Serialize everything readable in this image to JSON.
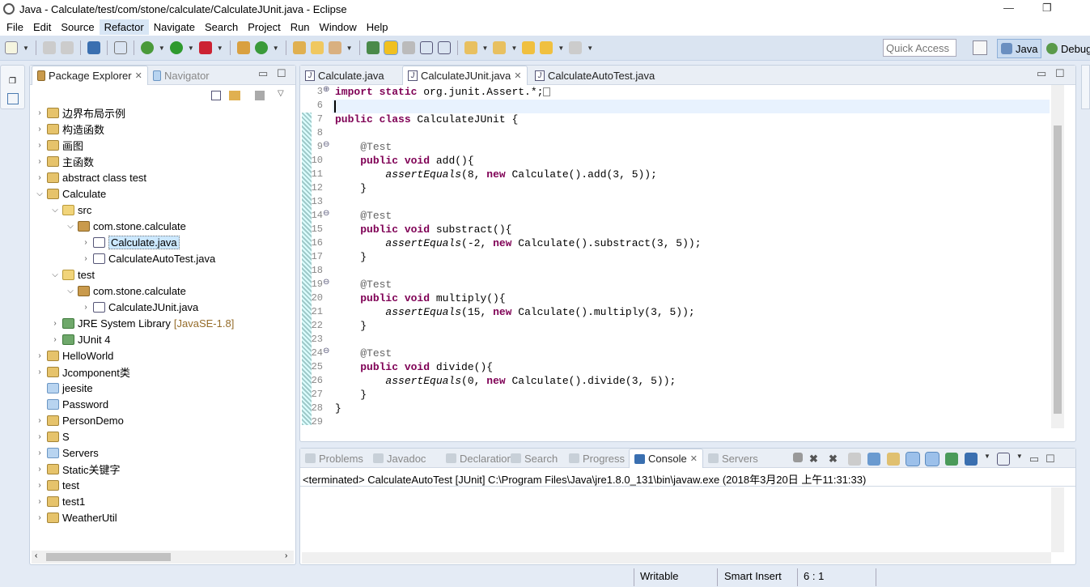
{
  "window": {
    "title": "Java - Calculate/test/com/stone/calculate/CalculateJUnit.java - Eclipse"
  },
  "menu": [
    "File",
    "Edit",
    "Source",
    "Refactor",
    "Navigate",
    "Search",
    "Project",
    "Run",
    "Window",
    "Help"
  ],
  "toolbar": {
    "quick_access_placeholder": "Quick Access",
    "perspectives": [
      "Java",
      "Debug"
    ]
  },
  "explorer": {
    "tabs": [
      {
        "label": "Package Explorer",
        "active": true
      },
      {
        "label": "Navigator",
        "active": false
      }
    ],
    "items": [
      {
        "label": "边界布局示例",
        "level": 0,
        "icon": "project",
        "arrow": "›"
      },
      {
        "label": "构造函数",
        "level": 0,
        "icon": "project",
        "arrow": "›"
      },
      {
        "label": "画图",
        "level": 0,
        "icon": "project",
        "arrow": "›"
      },
      {
        "label": "主函数",
        "level": 0,
        "icon": "project",
        "arrow": "›"
      },
      {
        "label": "abstract class test",
        "level": 0,
        "icon": "project",
        "arrow": "›"
      },
      {
        "label": "Calculate",
        "level": 0,
        "icon": "project",
        "arrow": "⌄"
      },
      {
        "label": "src",
        "level": 1,
        "icon": "source-folder",
        "arrow": "⌄"
      },
      {
        "label": "com.stone.calculate",
        "level": 2,
        "icon": "package",
        "arrow": "⌄"
      },
      {
        "label": "Calculate.java",
        "level": 3,
        "icon": "java-file",
        "arrow": "›",
        "selected": true
      },
      {
        "label": "CalculateAutoTest.java",
        "level": 3,
        "icon": "java-file",
        "arrow": "›"
      },
      {
        "label": "test",
        "level": 1,
        "icon": "source-folder",
        "arrow": "⌄"
      },
      {
        "label": "com.stone.calculate",
        "level": 2,
        "icon": "package",
        "arrow": "⌄"
      },
      {
        "label": "CalculateJUnit.java",
        "level": 3,
        "icon": "java-file",
        "arrow": "›"
      },
      {
        "label": "JRE System Library",
        "suffix": "[JavaSE-1.8]",
        "level": 1,
        "icon": "library",
        "arrow": "›"
      },
      {
        "label": "JUnit 4",
        "level": 1,
        "icon": "library",
        "arrow": "›"
      },
      {
        "label": "HelloWorld",
        "level": 0,
        "icon": "project",
        "arrow": "›"
      },
      {
        "label": "Jcomponent类",
        "level": 0,
        "icon": "project",
        "arrow": "›"
      },
      {
        "label": "jeesite",
        "level": 0,
        "icon": "folder",
        "arrow": ""
      },
      {
        "label": "Password",
        "level": 0,
        "icon": "folder",
        "arrow": ""
      },
      {
        "label": "PersonDemo",
        "level": 0,
        "icon": "project",
        "arrow": "›"
      },
      {
        "label": "S",
        "level": 0,
        "icon": "project",
        "arrow": "›"
      },
      {
        "label": "Servers",
        "level": 0,
        "icon": "folder",
        "arrow": "›"
      },
      {
        "label": "Static关键字",
        "level": 0,
        "icon": "project",
        "arrow": "›"
      },
      {
        "label": "test",
        "level": 0,
        "icon": "project",
        "arrow": "›"
      },
      {
        "label": "test1",
        "level": 0,
        "icon": "project",
        "arrow": "›"
      },
      {
        "label": "WeatherUtil",
        "level": 0,
        "icon": "project",
        "arrow": "›"
      }
    ]
  },
  "editor": {
    "tabs": [
      {
        "label": "Calculate.java",
        "active": false
      },
      {
        "label": "CalculateJUnit.java",
        "active": true
      },
      {
        "label": "CalculateAutoTest.java",
        "active": false
      }
    ],
    "lines": [
      {
        "n": "3",
        "fold": "+",
        "seg": [
          [
            "kw",
            "import static"
          ],
          [
            "",
            "org.junit.Assert.*;"
          ]
        ]
      },
      {
        "n": "6",
        "seg": []
      },
      {
        "n": "7",
        "seg": [
          [
            "kw",
            "public class"
          ],
          [
            "",
            " CalculateJUnit {"
          ]
        ]
      },
      {
        "n": "8",
        "seg": []
      },
      {
        "n": "9",
        "fold": "-",
        "seg": [
          [
            "",
            "    "
          ],
          [
            "an",
            "@Test"
          ]
        ]
      },
      {
        "n": "10",
        "seg": [
          [
            "",
            "    "
          ],
          [
            "kw",
            "public void"
          ],
          [
            "",
            " add(){"
          ]
        ]
      },
      {
        "n": "11",
        "seg": [
          [
            "",
            "        "
          ],
          [
            "it",
            "assertEquals"
          ],
          [
            "",
            "(8, "
          ],
          [
            "kw",
            "new"
          ],
          [
            "",
            " Calculate().add(3, 5));"
          ]
        ]
      },
      {
        "n": "12",
        "seg": [
          [
            "",
            "    }"
          ]
        ]
      },
      {
        "n": "13",
        "seg": []
      },
      {
        "n": "14",
        "fold": "-",
        "seg": [
          [
            "",
            "    "
          ],
          [
            "an",
            "@Test"
          ]
        ]
      },
      {
        "n": "15",
        "seg": [
          [
            "",
            "    "
          ],
          [
            "kw",
            "public void"
          ],
          [
            "",
            " substract(){"
          ]
        ]
      },
      {
        "n": "16",
        "seg": [
          [
            "",
            "        "
          ],
          [
            "it",
            "assertEquals"
          ],
          [
            "",
            "(-2, "
          ],
          [
            "kw",
            "new"
          ],
          [
            "",
            " Calculate().substract(3, 5));"
          ]
        ]
      },
      {
        "n": "17",
        "seg": [
          [
            "",
            "    }"
          ]
        ]
      },
      {
        "n": "18",
        "seg": []
      },
      {
        "n": "19",
        "fold": "-",
        "seg": [
          [
            "",
            "    "
          ],
          [
            "an",
            "@Test"
          ]
        ]
      },
      {
        "n": "20",
        "seg": [
          [
            "",
            "    "
          ],
          [
            "kw",
            "public void"
          ],
          [
            "",
            " multiply(){"
          ]
        ]
      },
      {
        "n": "21",
        "seg": [
          [
            "",
            "        "
          ],
          [
            "it",
            "assertEquals"
          ],
          [
            "",
            "(15, "
          ],
          [
            "kw",
            "new"
          ],
          [
            "",
            " Calculate().multiply(3, 5));"
          ]
        ]
      },
      {
        "n": "22",
        "seg": [
          [
            "",
            "    }"
          ]
        ]
      },
      {
        "n": "23",
        "seg": []
      },
      {
        "n": "24",
        "fold": "-",
        "seg": [
          [
            "",
            "    "
          ],
          [
            "an",
            "@Test"
          ]
        ]
      },
      {
        "n": "25",
        "seg": [
          [
            "",
            "    "
          ],
          [
            "kw",
            "public void"
          ],
          [
            "",
            " divide(){"
          ]
        ]
      },
      {
        "n": "26",
        "seg": [
          [
            "",
            "        "
          ],
          [
            "it",
            "assertEquals"
          ],
          [
            "",
            "(0, "
          ],
          [
            "kw",
            "new"
          ],
          [
            "",
            " Calculate().divide(3, 5));"
          ]
        ]
      },
      {
        "n": "27",
        "seg": [
          [
            "",
            "    }"
          ]
        ]
      },
      {
        "n": "28",
        "seg": [
          [
            "",
            "}"
          ]
        ]
      },
      {
        "n": "29",
        "seg": []
      }
    ]
  },
  "console": {
    "tabs": [
      {
        "label": "Problems"
      },
      {
        "label": "Javadoc"
      },
      {
        "label": "Declaration"
      },
      {
        "label": "Search"
      },
      {
        "label": "Progress"
      },
      {
        "label": "Console",
        "active": true
      },
      {
        "label": "Servers"
      }
    ],
    "header": "<terminated> CalculateAutoTest [JUnit] C:\\Program Files\\Java\\jre1.8.0_131\\bin\\javaw.exe (2018年3月20日 上午11:31:33)"
  },
  "status": {
    "writable": "Writable",
    "insert_mode": "Smart Insert",
    "position": "6 : 1"
  }
}
